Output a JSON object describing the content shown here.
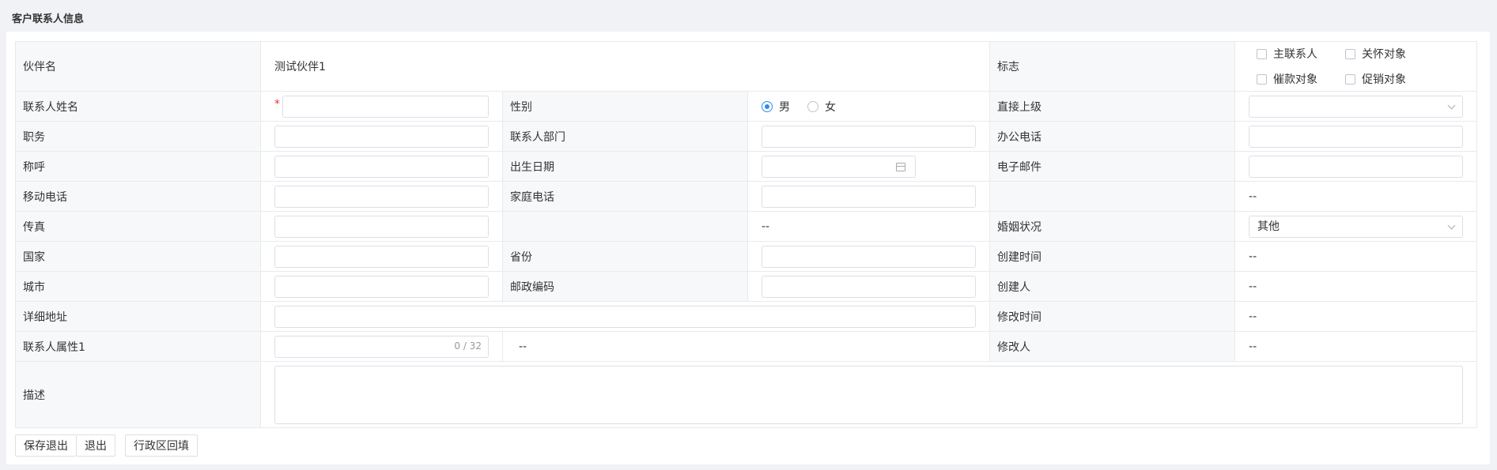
{
  "section": {
    "title": "客户联系人信息"
  },
  "labels": {
    "partner_name": "伙伴名",
    "flags": "标志",
    "contact_name": "联系人姓名",
    "gender": "性别",
    "direct_superior": "直接上级",
    "position": "职务",
    "contact_dept": "联系人部门",
    "office_phone": "办公电话",
    "salutation": "称呼",
    "birth_date": "出生日期",
    "email": "电子邮件",
    "mobile": "移动电话",
    "home_phone": "家庭电话",
    "fax": "传真",
    "marital_status": "婚姻状况",
    "country": "国家",
    "province": "省份",
    "created_time": "创建时间",
    "city": "城市",
    "postal_code": "邮政编码",
    "creator": "创建人",
    "address": "详细地址",
    "modified_time": "修改时间",
    "contact_attr1": "联系人属性1",
    "modifier": "修改人",
    "description": "描述"
  },
  "values": {
    "partner_name": "测试伙伴1",
    "required_mark": "*",
    "gender_options": [
      "男",
      "女"
    ],
    "gender_selected": "男",
    "marital_status": "其他",
    "attr1_counter": "0 / 32",
    "placeholder_dash": "--",
    "row5_dash": "--",
    "row6_dash": "--",
    "attr1_dash": "--",
    "created_time": "--",
    "creator": "--",
    "modified_time": "--",
    "modifier": "--"
  },
  "flags": [
    "主联系人",
    "关怀对象",
    "催款对象",
    "促销对象"
  ],
  "buttons": {
    "save_exit": "保存退出",
    "exit": "退出",
    "region_fill": "行政区回填"
  }
}
